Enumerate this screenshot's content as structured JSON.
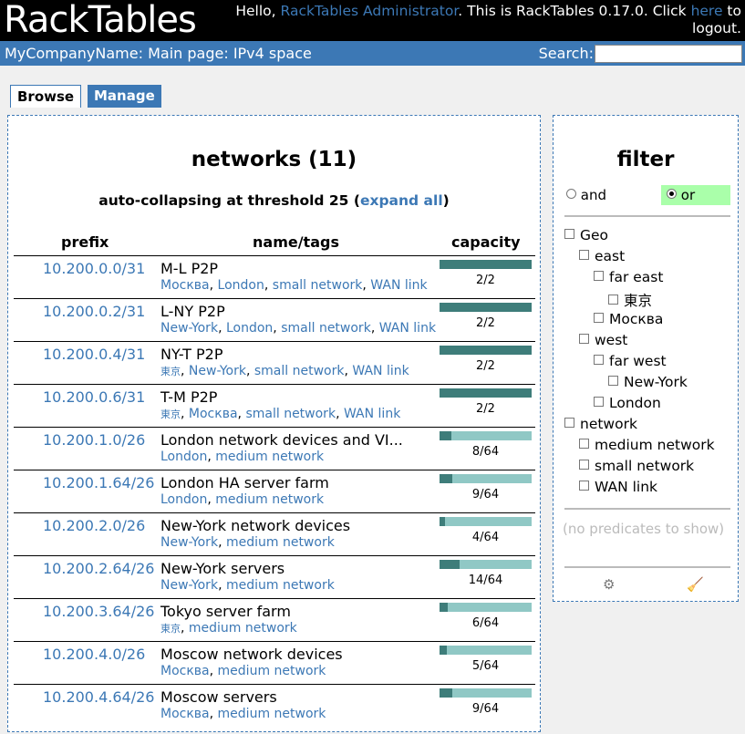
{
  "header": {
    "logo": "RackTables",
    "hello_pre": "Hello, ",
    "user": "RackTables Administrator",
    "hello_mid": ". This is RackTables 0.17.0. Click ",
    "here": "here",
    "hello_post": " to logout."
  },
  "path": {
    "company": "MyCompanyName",
    "main": "Main page",
    "page": "IPv4 space",
    "sep": ": "
  },
  "search": {
    "label": "Search:",
    "value": ""
  },
  "tabs": {
    "browse": "Browse",
    "manage": "Manage"
  },
  "networks": {
    "title": "networks (11)",
    "threshold_pre": "auto-collapsing at threshold 25 (",
    "expand_all": "expand all",
    "threshold_post": ")",
    "columns": {
      "prefix": "prefix",
      "name": "name/tags",
      "capacity": "capacity"
    },
    "rows": [
      {
        "prefix": "10.200.0.0/31",
        "name": "M-L P2P",
        "tags": [
          "Москва",
          "London",
          "small network",
          "WAN link"
        ],
        "used": 2,
        "total": 2
      },
      {
        "prefix": "10.200.0.2/31",
        "name": "L-NY P2P",
        "tags": [
          "New-York",
          "London",
          "small network",
          "WAN link"
        ],
        "used": 2,
        "total": 2
      },
      {
        "prefix": "10.200.0.4/31",
        "name": "NY-T P2P",
        "tags": [
          "東京",
          "New-York",
          "small network",
          "WAN link"
        ],
        "used": 2,
        "total": 2
      },
      {
        "prefix": "10.200.0.6/31",
        "name": "T-M P2P",
        "tags": [
          "東京",
          "Москва",
          "small network",
          "WAN link"
        ],
        "used": 2,
        "total": 2
      },
      {
        "prefix": "10.200.1.0/26",
        "name": "London network devices and VI...",
        "tags": [
          "London",
          "medium network"
        ],
        "used": 8,
        "total": 64
      },
      {
        "prefix": "10.200.1.64/26",
        "name": "London HA server farm",
        "tags": [
          "London",
          "medium network"
        ],
        "used": 9,
        "total": 64
      },
      {
        "prefix": "10.200.2.0/26",
        "name": "New-York network devices",
        "tags": [
          "New-York",
          "medium network"
        ],
        "used": 4,
        "total": 64
      },
      {
        "prefix": "10.200.2.64/26",
        "name": "New-York servers",
        "tags": [
          "New-York",
          "medium network"
        ],
        "used": 14,
        "total": 64
      },
      {
        "prefix": "10.200.3.64/26",
        "name": "Tokyo server farm",
        "tags": [
          "東京",
          "medium network"
        ],
        "used": 6,
        "total": 64
      },
      {
        "prefix": "10.200.4.0/26",
        "name": "Moscow network devices",
        "tags": [
          "Москва",
          "medium network"
        ],
        "used": 5,
        "total": 64
      },
      {
        "prefix": "10.200.4.64/26",
        "name": "Moscow servers",
        "tags": [
          "Москва",
          "medium network"
        ],
        "used": 9,
        "total": 64
      }
    ]
  },
  "filter": {
    "title": "filter",
    "and_label": "and",
    "or_label": "or",
    "tree": [
      {
        "label": "Geo",
        "level": 0
      },
      {
        "label": "east",
        "level": 1
      },
      {
        "label": "far east",
        "level": 2
      },
      {
        "label": "東京",
        "level": 3
      },
      {
        "label": "Москва",
        "level": 2
      },
      {
        "label": "west",
        "level": 1
      },
      {
        "label": "far west",
        "level": 2
      },
      {
        "label": "New-York",
        "level": 3
      },
      {
        "label": "London",
        "level": 2
      },
      {
        "label": "network",
        "level": 0
      },
      {
        "label": "medium network",
        "level": 1
      },
      {
        "label": "small network",
        "level": 1
      },
      {
        "label": "WAN link",
        "level": 1
      }
    ],
    "no_predicates": "(no predicates to show)",
    "gear_icon": "gear-icon",
    "broom_icon": "broom-icon"
  },
  "colors": {
    "brand_blue": "#3c78b5",
    "bar_used": "#3e7d7a",
    "bar_free": "#90c8c5",
    "or_highlight": "#aaffaa"
  }
}
